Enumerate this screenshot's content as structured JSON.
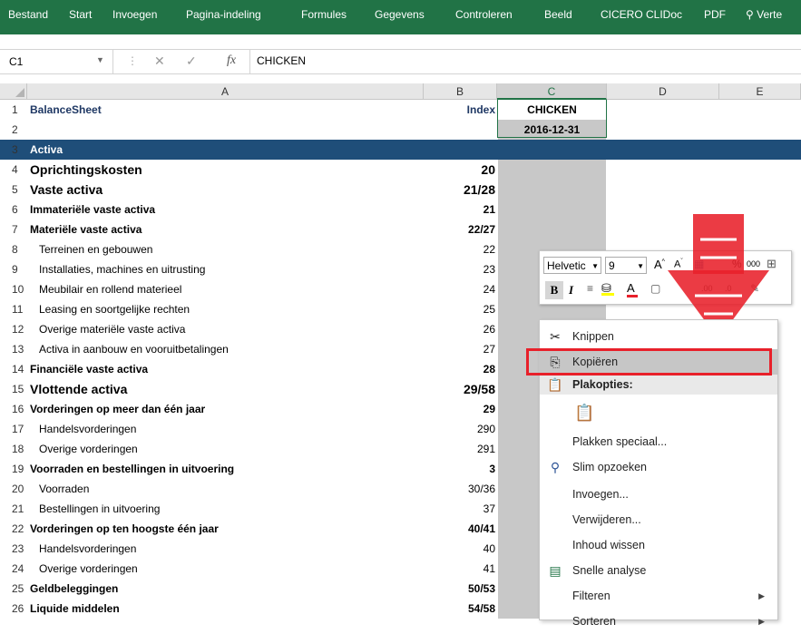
{
  "ribbon": {
    "tabs": [
      "Bestand",
      "Start",
      "Invoegen",
      "Pagina-indeling",
      "Formules",
      "Gegevens",
      "Controleren",
      "Beeld",
      "CICERO CLIDoc",
      "PDF",
      "Verte"
    ]
  },
  "formula_bar": {
    "name_box": "C1",
    "content": "CHICKEN",
    "fx_label": "fx"
  },
  "columns": [
    "A",
    "B",
    "C",
    "D",
    "E"
  ],
  "rows": [
    {
      "num": "1",
      "a": "BalanceSheet",
      "b": "Index",
      "c": "CHICKEN"
    },
    {
      "num": "2",
      "a": "",
      "b": "",
      "c": "2016-12-31"
    },
    {
      "num": "3",
      "a": "Activa",
      "b": "",
      "c": ""
    },
    {
      "num": "4",
      "a": "Oprichtingskosten",
      "b": "20",
      "c": ""
    },
    {
      "num": "5",
      "a": "Vaste activa",
      "b": "21/28",
      "c": ""
    },
    {
      "num": "6",
      "a": "Immateriële vaste activa",
      "b": "21",
      "c": ""
    },
    {
      "num": "7",
      "a": "Materiële vaste activa",
      "b": "22/27",
      "c": ""
    },
    {
      "num": "8",
      "a": "Terreinen en gebouwen",
      "b": "22",
      "c": ""
    },
    {
      "num": "9",
      "a": "Installaties, machines en uitrusting",
      "b": "23",
      "c": ""
    },
    {
      "num": "10",
      "a": "Meubilair en rollend materieel",
      "b": "24",
      "c": ""
    },
    {
      "num": "11",
      "a": "Leasing en soortgelijke rechten",
      "b": "25",
      "c": ""
    },
    {
      "num": "12",
      "a": "Overige materiële vaste activa",
      "b": "26",
      "c": ""
    },
    {
      "num": "13",
      "a": "Activa in aanbouw en vooruitbetalingen",
      "b": "27",
      "c": ""
    },
    {
      "num": "14",
      "a": "Financiële vaste activa",
      "b": "28",
      "c": ""
    },
    {
      "num": "15",
      "a": "Vlottende activa",
      "b": "29/58",
      "c": ""
    },
    {
      "num": "16",
      "a": "Vorderingen op meer dan één jaar",
      "b": "29",
      "c": ""
    },
    {
      "num": "17",
      "a": "Handelsvorderingen",
      "b": "290",
      "c": ""
    },
    {
      "num": "18",
      "a": "Overige vorderingen",
      "b": "291",
      "c": ""
    },
    {
      "num": "19",
      "a": "Voorraden en bestellingen in uitvoering",
      "b": "3",
      "c": ""
    },
    {
      "num": "20",
      "a": "Voorraden",
      "b": "30/36",
      "c": ""
    },
    {
      "num": "21",
      "a": "Bestellingen in uitvoering",
      "b": "37",
      "c": ""
    },
    {
      "num": "22",
      "a": "Vorderingen op ten hoogste één jaar",
      "b": "40/41",
      "c": ""
    },
    {
      "num": "23",
      "a": "Handelsvorderingen",
      "b": "40",
      "c": ""
    },
    {
      "num": "24",
      "a": "Overige vorderingen",
      "b": "41",
      "c": ""
    },
    {
      "num": "25",
      "a": "Geldbeleggingen",
      "b": "50/53",
      "c": ""
    },
    {
      "num": "26",
      "a": "Liquide middelen",
      "b": "54/58",
      "c": ""
    }
  ],
  "mini_toolbar": {
    "font_name": "Helvetic",
    "font_size": "9",
    "bold": "B",
    "italic": "I",
    "thousands": "000"
  },
  "context_menu": {
    "items": [
      {
        "label": "Knippen",
        "icon": "scissors-icon"
      },
      {
        "label": "Kopiëren",
        "icon": "copy-icon"
      },
      {
        "label": "Plakopties:",
        "icon": "paste-icon"
      },
      {
        "label": "",
        "icon": "paste-option-icon"
      },
      {
        "label": "Plakken speciaal...",
        "icon": ""
      },
      {
        "label": "Slim opzoeken",
        "icon": "smart-lookup-icon"
      },
      {
        "label": "Invoegen...",
        "icon": ""
      },
      {
        "label": "Verwijderen...",
        "icon": ""
      },
      {
        "label": "Inhoud wissen",
        "icon": ""
      },
      {
        "label": "Snelle analyse",
        "icon": "quick-analysis-icon"
      },
      {
        "label": "Filteren",
        "icon": ""
      },
      {
        "label": "Sorteren",
        "icon": ""
      }
    ]
  },
  "colors": {
    "ribbon": "#217346",
    "section_header": "#1f4e79",
    "highlight_box": "#e8202a",
    "arrow": "#e8202a"
  }
}
